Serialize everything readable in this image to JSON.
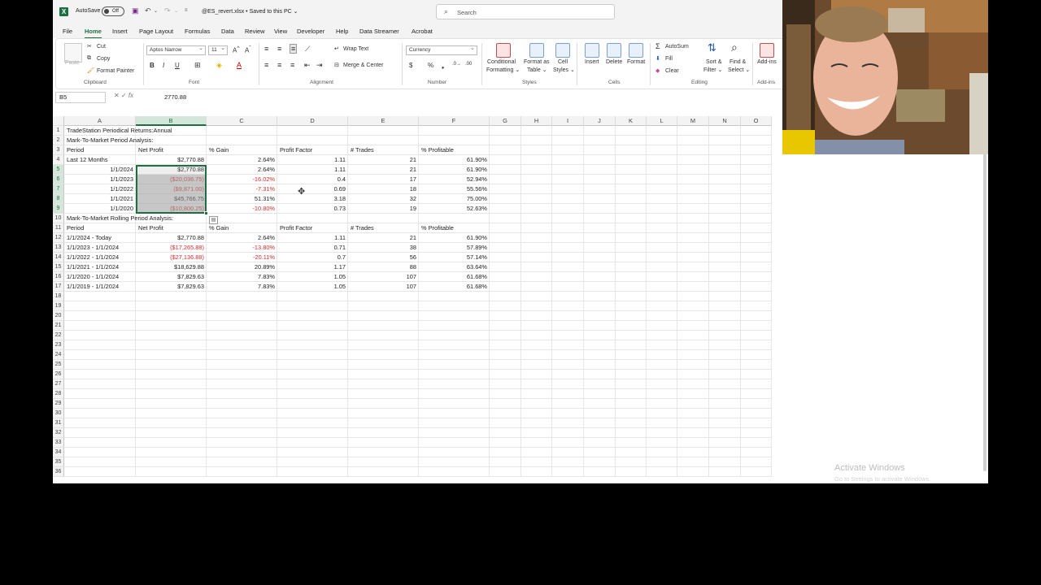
{
  "title_bar": {
    "autosave_label": "AutoSave",
    "autosave_state": "Off",
    "filename": "@ES_revert.xlsx • Saved to this PC ⌄",
    "search_placeholder": "Search"
  },
  "menu_tabs": [
    "File",
    "Home",
    "Insert",
    "Page Layout",
    "Formulas",
    "Data",
    "Review",
    "View",
    "Developer",
    "Help",
    "Data Streamer",
    "Acrobat"
  ],
  "active_tab": "Home",
  "ribbon": {
    "clipboard": {
      "paste": "Paste",
      "cut": "Cut",
      "copy": "Copy",
      "format_painter": "Format Painter",
      "label": "Clipboard"
    },
    "font": {
      "name": "Aptos Narrow",
      "size": "11",
      "label": "Font"
    },
    "alignment": {
      "wrap_text": "Wrap Text",
      "merge_center": "Merge & Center",
      "label": "Alignment"
    },
    "number": {
      "format": "Currency",
      "label": "Number"
    },
    "styles": {
      "conditional_1": "Conditional",
      "conditional_2": "Formatting ⌄",
      "format_table_1": "Format as",
      "format_table_2": "Table ⌄",
      "cell_styles_1": "Cell",
      "cell_styles_2": "Styles ⌄",
      "label": "Styles"
    },
    "cells": {
      "insert": "Insert",
      "delete": "Delete",
      "format": "Format",
      "label": "Cells"
    },
    "editing": {
      "autosum": "AutoSum",
      "fill": "Fill",
      "clear": "Clear",
      "sort_filter_1": "Sort &",
      "sort_filter_2": "Filter ⌄",
      "find_select_1": "Find &",
      "find_select_2": "Select ⌄",
      "label": "Editing"
    },
    "addins": {
      "button": "Add-ins",
      "label": "Add-ins"
    }
  },
  "formula_bar": {
    "name_box": "B5",
    "fx": "fx",
    "value": "2770.88"
  },
  "columns": [
    "A",
    "B",
    "C",
    "D",
    "E",
    "F",
    "G",
    "H",
    "I",
    "J",
    "K",
    "L",
    "M",
    "N",
    "O"
  ],
  "rows": [
    [
      "TradeStation Periodical Returns:Annual",
      "",
      "",
      "",
      "",
      ""
    ],
    [
      "Mark-To-Market Period Analysis:",
      "",
      "",
      "",
      "",
      ""
    ],
    [
      "Period",
      "Net Profit",
      "% Gain",
      "Profit Factor",
      "# Trades",
      "% Profitable"
    ],
    [
      "Last 12 Months",
      "$2,770.88",
      "2.64%",
      "1.11",
      "21",
      "61.90%"
    ],
    [
      "1/1/2024",
      "$2,770.88",
      "2.64%",
      "1.11",
      "21",
      "61.90%"
    ],
    [
      "1/1/2023",
      "($20,036.75)",
      "-16.02%",
      "0.4",
      "17",
      "52.94%"
    ],
    [
      "1/1/2022",
      "($9,871.00)",
      "-7.31%",
      "0.69",
      "18",
      "55.56%"
    ],
    [
      "1/1/2021",
      "$45,766.75",
      "51.31%",
      "3.18",
      "32",
      "75.00%"
    ],
    [
      "1/1/2020",
      "($10,800.25)",
      "-10.80%",
      "0.73",
      "19",
      "52.63%"
    ],
    [
      "Mark-To-Market Rolling Period Analysis:",
      "",
      "",
      "",
      "",
      ""
    ],
    [
      "Period",
      "Net Profit",
      "% Gain",
      "Profit Factor",
      "# Trades",
      "% Profitable"
    ],
    [
      "1/1/2024 - Today",
      "$2,770.88",
      "2.64%",
      "1.11",
      "21",
      "61.90%"
    ],
    [
      "1/1/2023 - 1/1/2024",
      "($17,265.88)",
      "-13.80%",
      "0.71",
      "38",
      "57.89%"
    ],
    [
      "1/1/2022 - 1/1/2024",
      "($27,136.88)",
      "-20.11%",
      "0.7",
      "56",
      "57.14%"
    ],
    [
      "1/1/2021 - 1/1/2024",
      "$18,629.88",
      "20.89%",
      "1.17",
      "88",
      "63.64%"
    ],
    [
      "1/1/2020 - 1/1/2024",
      "$7,829.63",
      "7.83%",
      "1.05",
      "107",
      "61.68%"
    ],
    [
      "1/1/2019 - 1/1/2024",
      "$7,829.63",
      "7.83%",
      "1.05",
      "107",
      "61.68%"
    ]
  ],
  "row_numbers": [
    "1",
    "2",
    "3",
    "4",
    "5",
    "6",
    "7",
    "8",
    "9",
    "10",
    "11",
    "12",
    "13",
    "14",
    "15",
    "16",
    "17",
    "18",
    "19",
    "20",
    "21",
    "22",
    "23",
    "24",
    "25",
    "26",
    "27",
    "28",
    "29",
    "30",
    "31",
    "32",
    "33",
    "34",
    "35",
    "36"
  ],
  "selected_cell": "B5",
  "watermark": {
    "line1": "Activate Windows",
    "line2": "Go to Settings to activate Windows."
  },
  "colors": {
    "excel_green": "#1d6f42",
    "negative_red": "#d62b2b"
  }
}
